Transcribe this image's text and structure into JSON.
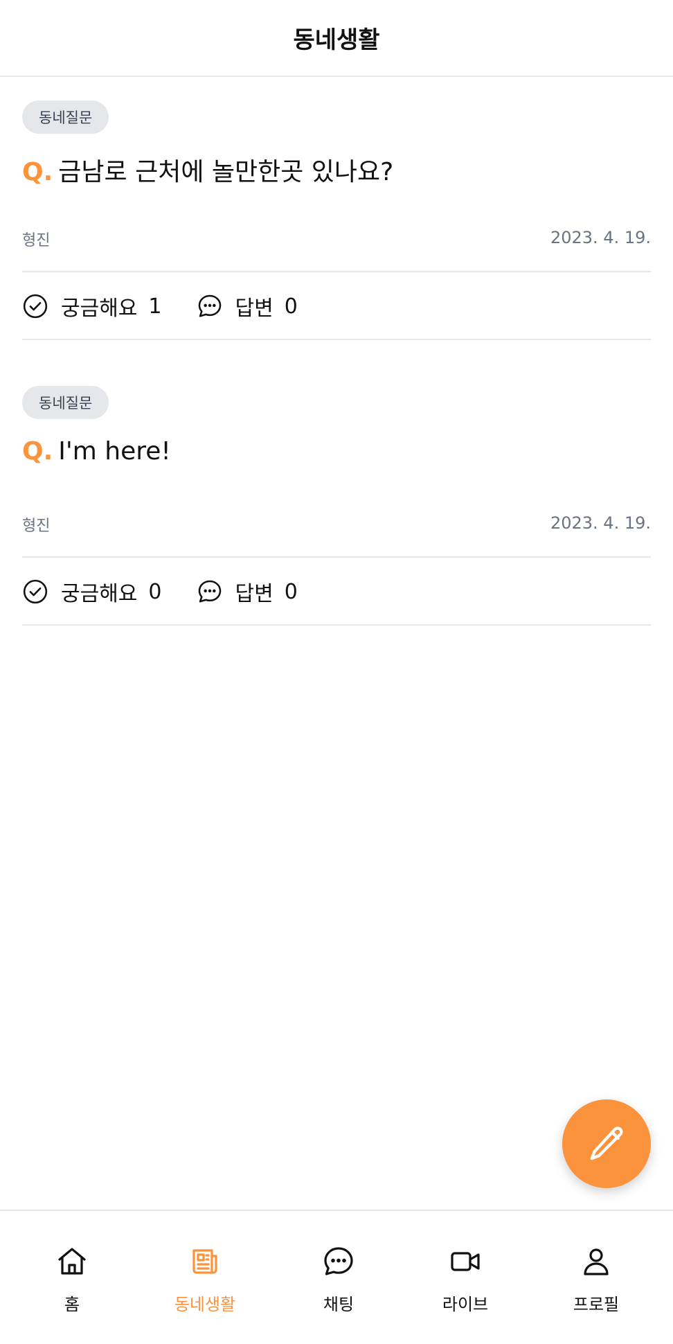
{
  "header": {
    "title": "동네생활"
  },
  "posts": [
    {
      "tag": "동네질문",
      "q_mark": "Q.",
      "question": "금남로 근처에 놀만한곳 있나요?",
      "author": "형진",
      "date": "2023. 4. 19.",
      "curious_label": "궁금해요",
      "curious_count": "1",
      "answer_label": "답변",
      "answer_count": "0"
    },
    {
      "tag": "동네질문",
      "q_mark": "Q.",
      "question": "I'm here!",
      "author": "형진",
      "date": "2023. 4. 19.",
      "curious_label": "궁금해요",
      "curious_count": "0",
      "answer_label": "답변",
      "answer_count": "0"
    }
  ],
  "fab": {
    "icon": "pencil-icon"
  },
  "nav": {
    "items": [
      {
        "label": "홈",
        "icon": "home-icon",
        "active": false
      },
      {
        "label": "동네생활",
        "icon": "newspaper-icon",
        "active": true
      },
      {
        "label": "채팅",
        "icon": "chat-icon",
        "active": false
      },
      {
        "label": "라이브",
        "icon": "video-icon",
        "active": false
      },
      {
        "label": "프로필",
        "icon": "user-icon",
        "active": false
      }
    ]
  },
  "colors": {
    "accent": "#fb923c",
    "divider": "#e5e7eb",
    "muted": "#6b7280",
    "tag_bg": "#e5e7eb"
  }
}
